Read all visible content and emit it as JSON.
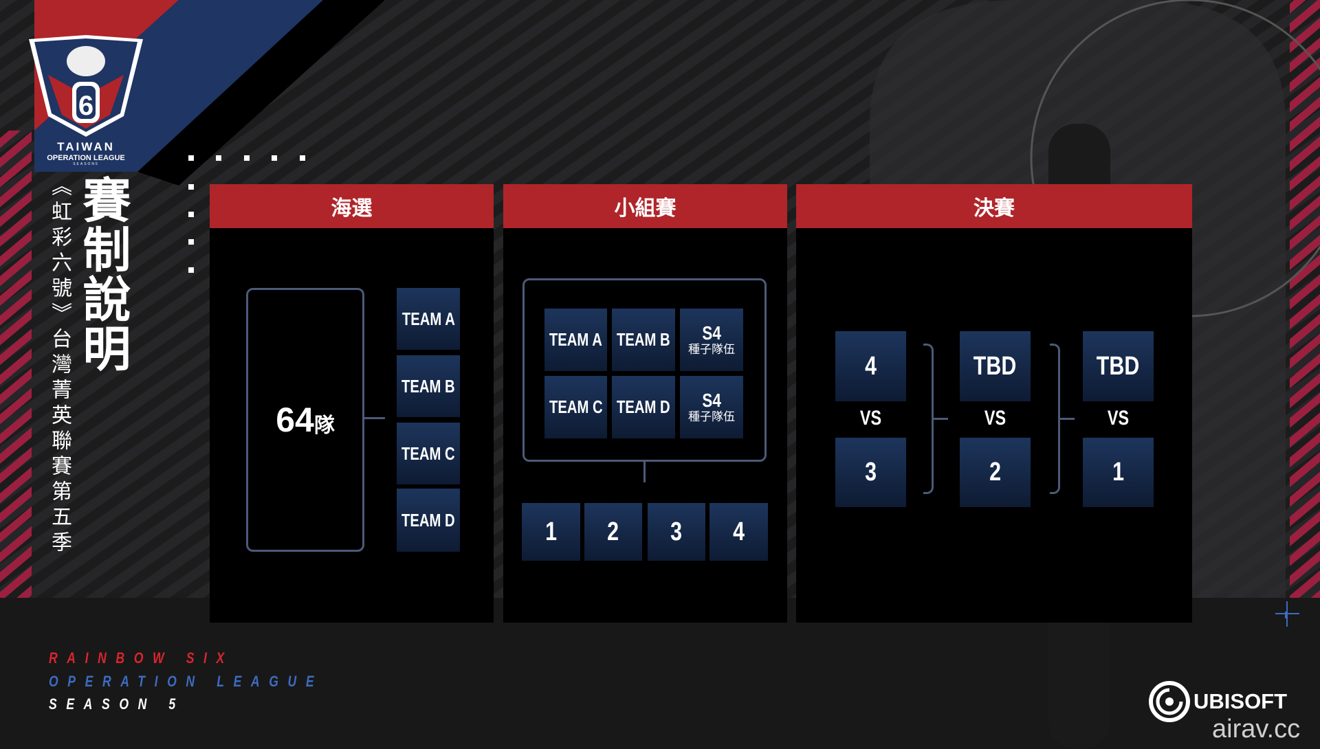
{
  "branding": {
    "league_logo_text": [
      "TAIWAN",
      "OPERATION LEAGUE",
      "SEASON5"
    ],
    "vertical_subtitle": "《虹彩六號》台灣菁英聯賽第五季",
    "vertical_title": "賽制說明",
    "tagline": [
      "RAINBOW SIX",
      "OPERATION LEAGUE",
      "SEASON 5"
    ],
    "publisher": "UBISOFT",
    "watermark": "airav.cc"
  },
  "colors": {
    "header_red": "#b0252a",
    "box_navy": "#1d355c",
    "tag_red": "#d8262c",
    "tag_blue": "#3d6cc0"
  },
  "stages": {
    "qualifier": {
      "title": "海選",
      "pool_count": "64",
      "pool_unit": "隊",
      "teams": [
        "TEAM A",
        "TEAM B",
        "TEAM C",
        "TEAM D"
      ]
    },
    "group": {
      "title": "小組賽",
      "grid": [
        {
          "label": "TEAM A"
        },
        {
          "label": "TEAM B"
        },
        {
          "label": "S4",
          "sub": "種子隊伍"
        },
        {
          "label": "TEAM C"
        },
        {
          "label": "TEAM D"
        },
        {
          "label": "S4",
          "sub": "種子隊伍"
        }
      ],
      "rankings": [
        "1",
        "2",
        "3",
        "4"
      ]
    },
    "finals": {
      "title": "決賽",
      "vs_label": "VS",
      "matches": [
        {
          "top": "4",
          "bottom": "3"
        },
        {
          "top": "TBD",
          "bottom": "2"
        },
        {
          "top": "TBD",
          "bottom": "1"
        }
      ]
    }
  }
}
